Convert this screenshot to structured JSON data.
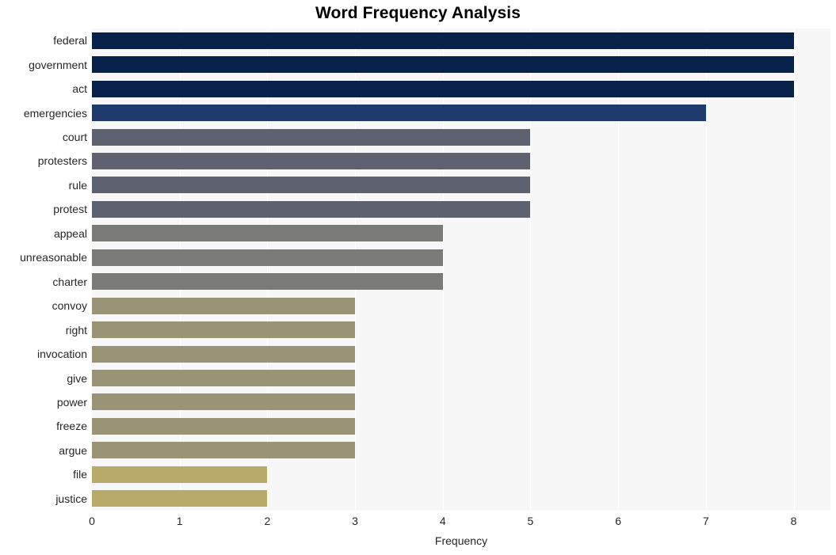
{
  "chart_data": {
    "type": "bar",
    "orientation": "horizontal",
    "title": "Word Frequency Analysis",
    "xlabel": "Frequency",
    "ylabel": "",
    "xlim": [
      0,
      8.42
    ],
    "xticks": [
      0,
      1,
      2,
      3,
      4,
      5,
      6,
      7,
      8
    ],
    "xtick_labels": [
      "0",
      "1",
      "2",
      "3",
      "4",
      "5",
      "6",
      "7",
      "8"
    ],
    "grid": "vertical-only",
    "legend": "none",
    "plot_background": "#f7f7f7",
    "gridline_color": "#ffffff",
    "categories": [
      "federal",
      "government",
      "act",
      "emergencies",
      "court",
      "protesters",
      "rule",
      "protest",
      "appeal",
      "unreasonable",
      "charter",
      "convoy",
      "right",
      "invocation",
      "give",
      "power",
      "freeze",
      "argue",
      "file",
      "justice"
    ],
    "values": [
      8,
      8,
      8,
      7,
      5,
      5,
      5,
      5,
      4,
      4,
      4,
      3,
      3,
      3,
      3,
      3,
      3,
      3,
      2,
      2
    ],
    "bar_colors": [
      "#08214a",
      "#08214a",
      "#08214a",
      "#1e3a6d",
      "#5d6170",
      "#5d6170",
      "#5d6170",
      "#5d6170",
      "#7a7a77",
      "#7a7a77",
      "#7a7a77",
      "#9a9375",
      "#9a9375",
      "#9a9375",
      "#9a9375",
      "#9a9375",
      "#9a9375",
      "#9a9375",
      "#b8ab6a",
      "#b8ab6a"
    ]
  }
}
